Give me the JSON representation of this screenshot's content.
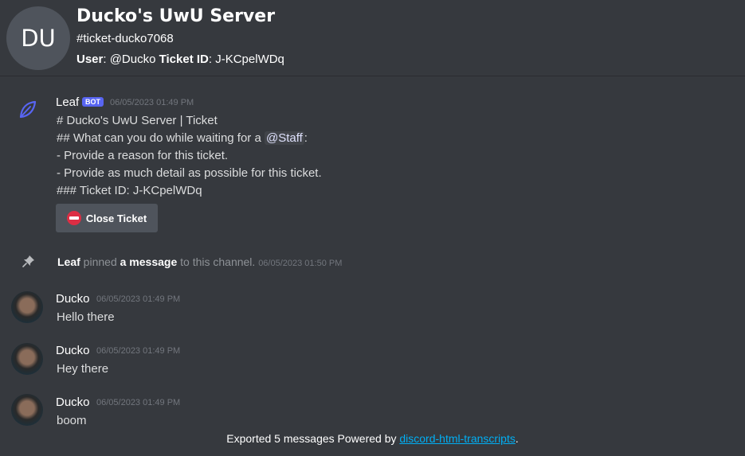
{
  "header": {
    "guild_icon_text": "DU",
    "guild_name": "Ducko's UwU Server",
    "channel_name": "#ticket-ducko7068",
    "user_label": "User",
    "user_value": "@Ducko",
    "ticket_label": "Ticket ID",
    "ticket_value": "J-KCpelWDq"
  },
  "messages": [
    {
      "author": "Leaf",
      "bot_tag": "BOT",
      "timestamp": "06/05/2023 01:49 PM",
      "lines": [
        "# Ducko's UwU Server | Ticket",
        "## What can you do while waiting for a ",
        "- Provide a reason for this ticket.",
        "- Provide as much detail as possible for this ticket.",
        "### Ticket ID: J-KCpelWDq"
      ],
      "mention": "@Staff",
      "mention_suffix": ":",
      "button_label": "Close Ticket"
    },
    {
      "author": "Ducko",
      "timestamp": "06/05/2023 01:49 PM",
      "text": "Hello there"
    },
    {
      "author": "Ducko",
      "timestamp": "06/05/2023 01:49 PM",
      "text": "Hey there"
    },
    {
      "author": "Ducko",
      "timestamp": "06/05/2023 01:49 PM",
      "text": "boom"
    }
  ],
  "pin_notice": {
    "author": "Leaf",
    "verb": " pinned ",
    "target": "a message",
    "suffix": " to this channel.",
    "timestamp": "06/05/2023 01:50 PM"
  },
  "footer": {
    "prefix": "Exported 5 messages Powered by ",
    "link": "discord-html-transcripts",
    "suffix": "."
  },
  "colors": {
    "background": "#36393e",
    "bot_tag": "#5865f2",
    "link": "#00aff4",
    "leaf_icon": "#5865f2"
  },
  "icons": {
    "bot_avatar": "leaf-icon",
    "pin": "pin-icon",
    "close_ticket": "no-entry-icon"
  }
}
